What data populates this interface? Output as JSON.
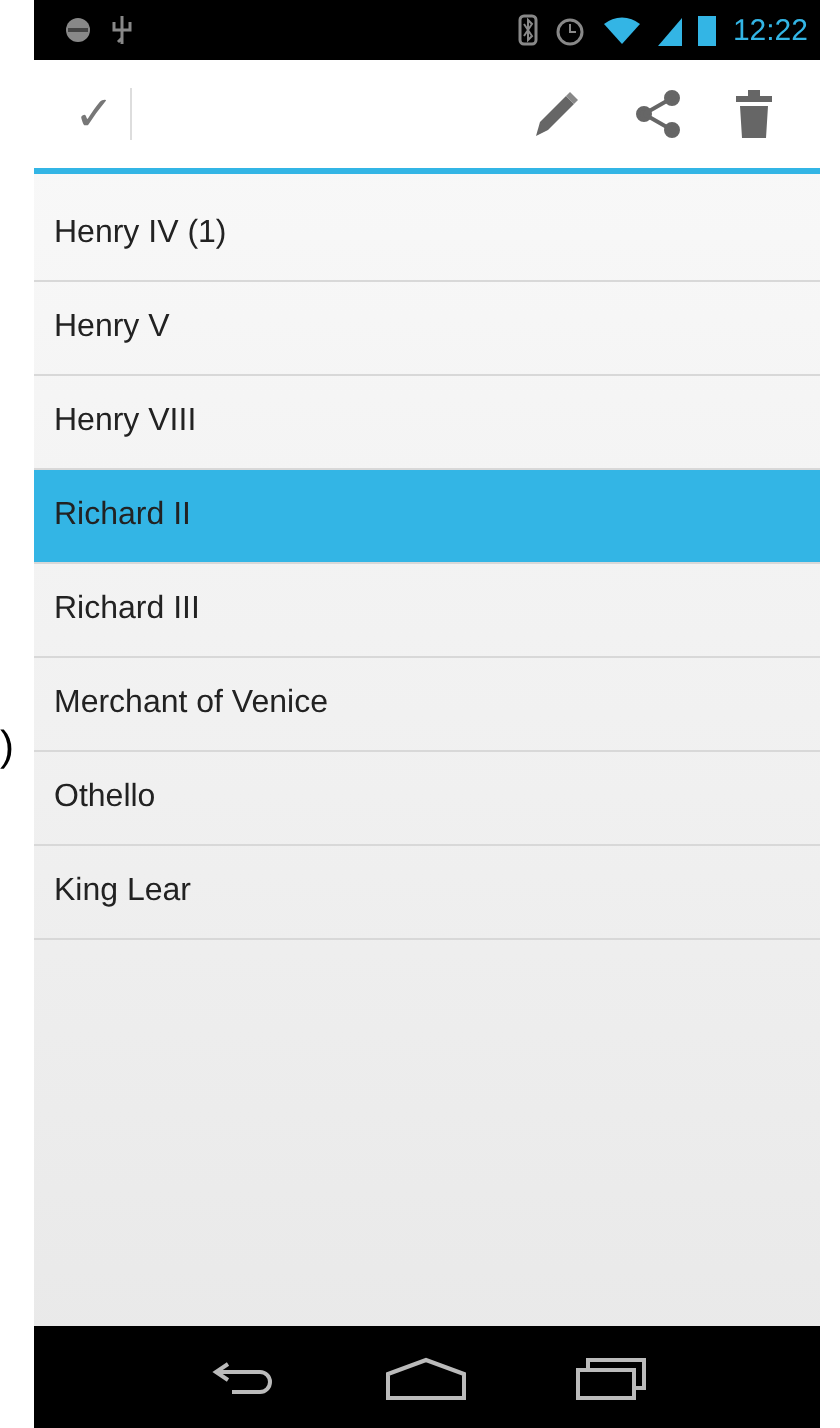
{
  "stray_text": ")",
  "status_bar": {
    "time": "12:22"
  },
  "action_bar": {
    "done": {
      "label": "✓"
    }
  },
  "list": [
    {
      "label": "Henry IV (1)",
      "selected": false
    },
    {
      "label": "Henry V",
      "selected": false
    },
    {
      "label": "Henry VIII",
      "selected": false
    },
    {
      "label": "Richard II",
      "selected": true
    },
    {
      "label": "Richard III",
      "selected": false
    },
    {
      "label": "Merchant of Venice",
      "selected": false
    },
    {
      "label": "Othello",
      "selected": false
    },
    {
      "label": "King Lear",
      "selected": false
    }
  ]
}
